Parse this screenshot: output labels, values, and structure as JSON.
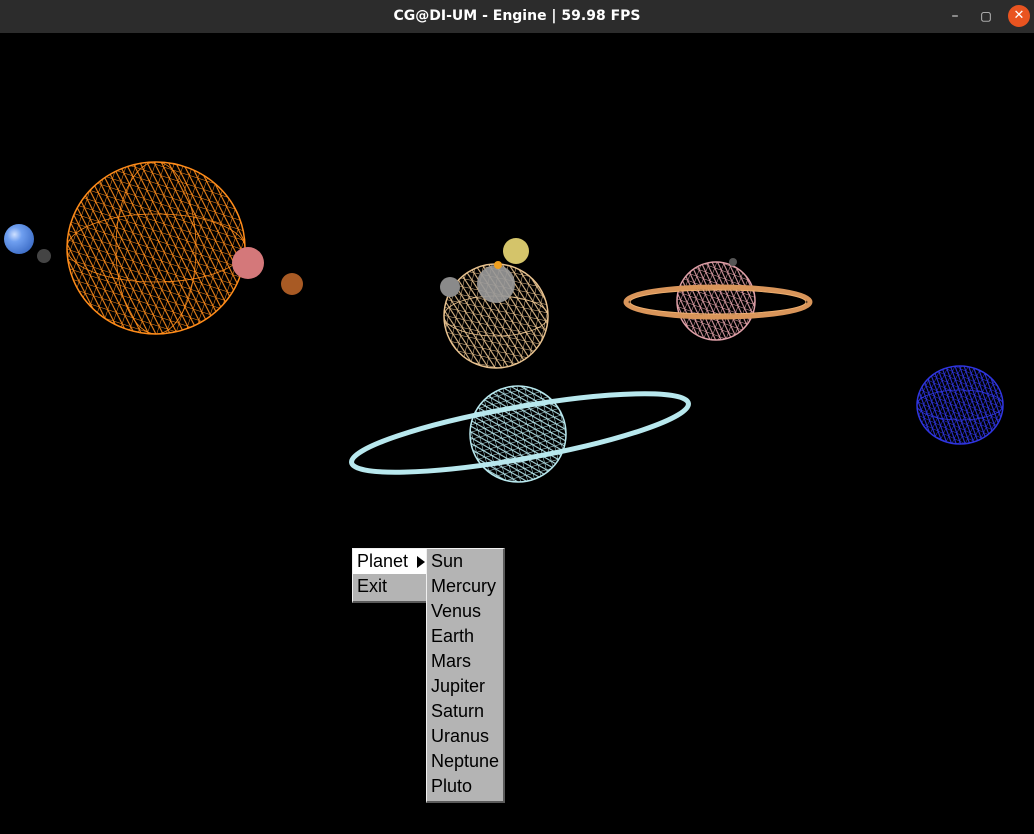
{
  "window": {
    "title": "CG@DI-UM - Engine | 59.98 FPS",
    "controls": {
      "minimize": "–",
      "maximize": "▢",
      "close": "✕"
    }
  },
  "scene": {
    "background": "#000000",
    "bodies": [
      {
        "name": "sun",
        "color": "#ff8c1a",
        "style": "wireframe"
      },
      {
        "name": "mercury",
        "color": "#5f8fe8",
        "style": "solid"
      },
      {
        "name": "venus",
        "color": "#d4787a",
        "style": "solid"
      },
      {
        "name": "earth",
        "color": "#a85a24",
        "style": "solid"
      },
      {
        "name": "mars",
        "color": "#444444",
        "style": "solid"
      },
      {
        "name": "jupiter",
        "color": "#e8c28f",
        "style": "wireframe"
      },
      {
        "name": "jupiter-moon-a",
        "color": "#d4c46a",
        "style": "solid"
      },
      {
        "name": "jupiter-moon-b",
        "color": "#8a8a8a",
        "style": "solid"
      },
      {
        "name": "jupiter-moon-c",
        "color": "#9a9a9a",
        "style": "solid"
      },
      {
        "name": "saturn",
        "color": "#e0a0a8",
        "style": "wireframe",
        "ring_color": "#d9955a"
      },
      {
        "name": "uranus",
        "color": "#b8e8ee",
        "style": "wireframe",
        "ring_color": "#b8e8ee"
      },
      {
        "name": "neptune",
        "color": "#2f35e0",
        "style": "wireframe"
      }
    ]
  },
  "context_menu": {
    "items": [
      {
        "label": "Planet",
        "has_submenu": true,
        "highlighted": true
      },
      {
        "label": "Exit",
        "has_submenu": false,
        "highlighted": false
      }
    ]
  },
  "planet_submenu": {
    "items": [
      "Sun",
      "Mercury",
      "Venus",
      "Earth",
      "Mars",
      "Jupiter",
      "Saturn",
      "Uranus",
      "Neptune",
      "Pluto"
    ]
  }
}
